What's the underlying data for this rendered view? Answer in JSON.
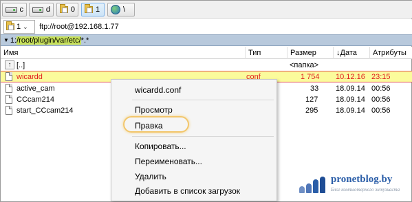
{
  "drive_bar": {
    "drives": [
      {
        "label": "c",
        "icon": "hard-drive-icon"
      },
      {
        "label": "d",
        "icon": "hard-drive-icon"
      },
      {
        "label": "0",
        "icon": "network-folder-icon"
      },
      {
        "label": "1",
        "icon": "network-folder-icon"
      },
      {
        "label": "\\",
        "icon": "globe-icon"
      }
    ]
  },
  "path_bar": {
    "drive_selected": "1",
    "ftp_path": "ftp://root@192.168.1.77"
  },
  "current_path": {
    "prefix": "1:",
    "highlighted": "/root/plugin/var/etc/",
    "mask": "*.*"
  },
  "columns": {
    "name": "Имя",
    "type": "Тип",
    "size": "Размер",
    "date": "Дата",
    "date_sort_arrow": "↓",
    "attributes": "Атрибуты"
  },
  "files": [
    {
      "name": "[..]",
      "type": "",
      "size": "<папка>",
      "date": "",
      "time": ""
    },
    {
      "name": "wicardd",
      "type": "conf",
      "size": "1 754",
      "date": "10.12.16",
      "time": "23:15"
    },
    {
      "name": "active_cam",
      "type": "",
      "size": "33",
      "date": "18.09.14",
      "time": "00:56"
    },
    {
      "name": "CCcam214",
      "type": "",
      "size": "127",
      "date": "18.09.14",
      "time": "00:56"
    },
    {
      "name": "start_CCcam214",
      "type": "",
      "size": "295",
      "date": "18.09.14",
      "time": "00:56"
    }
  ],
  "context_menu": {
    "title": "wicardd.conf",
    "items": [
      "Просмотр",
      "Правка",
      "Копировать...",
      "Переименовать...",
      "Удалить",
      "Добавить в список загрузок"
    ]
  },
  "brand": {
    "name": "pronetblog.by",
    "tagline": "Блог компьютерного энтузиаста"
  },
  "colors": {
    "selected_row_bg": "#fbfb9c",
    "selected_text": "#e02020",
    "path_bar_bg": "#b8c9dc",
    "path_highlight": "#c6e05a",
    "menu_highlight_ring": "#f2c66b",
    "brand_blue": "#2b5ea8"
  }
}
